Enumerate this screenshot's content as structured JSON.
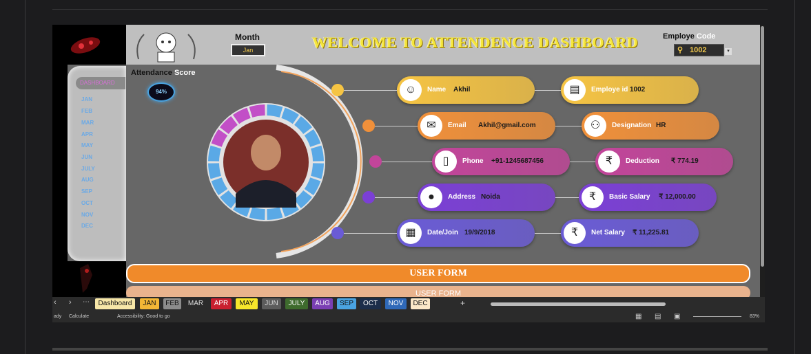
{
  "header": {
    "title": "WELCOME TO ATTENDENCE DASHBOARD",
    "month_label": "Month",
    "month_value": "Jan",
    "employee_label": "Employe",
    "employee_label_highlight": "Code",
    "employee_code": "1002"
  },
  "attendance": {
    "label": "Attendance",
    "label_highlight": "Score",
    "score": "94%",
    "ring_fraction": 0.94
  },
  "nav": {
    "active": "DASHBOARD",
    "months": [
      "JAN",
      "FEB",
      "MAR",
      "APR",
      "MAY",
      "JUN",
      "JULY",
      "AUG",
      "SEP",
      "OCT",
      "NOV",
      "DEC"
    ]
  },
  "details": [
    {
      "label": "Name",
      "value": "Akhil",
      "icon": "user-icon",
      "color": "#f6c443"
    },
    {
      "label": "Employe id",
      "value": "1002",
      "icon": "id-card-icon",
      "color": "#f6c443"
    },
    {
      "label": "Email",
      "value": "Akhil@gmail.com",
      "icon": "mail-icon",
      "color": "#f0903a"
    },
    {
      "label": "Designation",
      "value": "HR",
      "icon": "org-icon",
      "color": "#f0903a"
    },
    {
      "label": "Phone",
      "value": "+91-1245687456",
      "icon": "phone-icon",
      "color": "#c2459a"
    },
    {
      "label": "Deduction",
      "value": "₹ 774.19",
      "icon": "no-rupee-icon",
      "color": "#c2459a"
    },
    {
      "label": "Address",
      "value": "Noida",
      "icon": "location-icon",
      "color": "#7b3fd6"
    },
    {
      "label": "Basic Salary",
      "value": "₹ 12,000.00",
      "icon": "rupee-icon",
      "color": "#7b3fd6"
    },
    {
      "label": "Date/Join",
      "value": "19/9/2018",
      "icon": "calendar-icon",
      "color": "#6a5bd6"
    },
    {
      "label": "Net Salary",
      "value": "₹ 11,225.81",
      "icon": "rupee-icon",
      "color": "#6a5bd6"
    }
  ],
  "buttons": {
    "user_form": "USER FORM",
    "second_form": "USER FORM"
  },
  "tabs": [
    {
      "label": "Dashboard",
      "bg": "#f7e7a8",
      "fg": "#111"
    },
    {
      "label": "JAN",
      "bg": "#f2b636",
      "fg": "#111"
    },
    {
      "label": "FEB",
      "bg": "#8c8c8c",
      "fg": "#111"
    },
    {
      "label": "MAR",
      "bg": "#2b2b2b",
      "fg": "#ddd"
    },
    {
      "label": "APR",
      "bg": "#c9202f",
      "fg": "#fff"
    },
    {
      "label": "MAY",
      "bg": "#f7e62b",
      "fg": "#111"
    },
    {
      "label": "JUN",
      "bg": "#5c5c5c",
      "fg": "#ddd"
    },
    {
      "label": "JULY",
      "bg": "#3e6b2d",
      "fg": "#fff"
    },
    {
      "label": "AUG",
      "bg": "#7a3fb3",
      "fg": "#fff"
    },
    {
      "label": "SEP",
      "bg": "#4aa3e0",
      "fg": "#111"
    },
    {
      "label": "OCT",
      "bg": "#1c2d4a",
      "fg": "#fff"
    },
    {
      "label": "NOV",
      "bg": "#2f69b8",
      "fg": "#fff"
    },
    {
      "label": "DEC",
      "bg": "#fbe8c8",
      "fg": "#111"
    }
  ],
  "status": {
    "ready": "ady",
    "calculate": "Calculate",
    "accessibility": "Accessibility: Good to go",
    "zoom": "83%"
  }
}
